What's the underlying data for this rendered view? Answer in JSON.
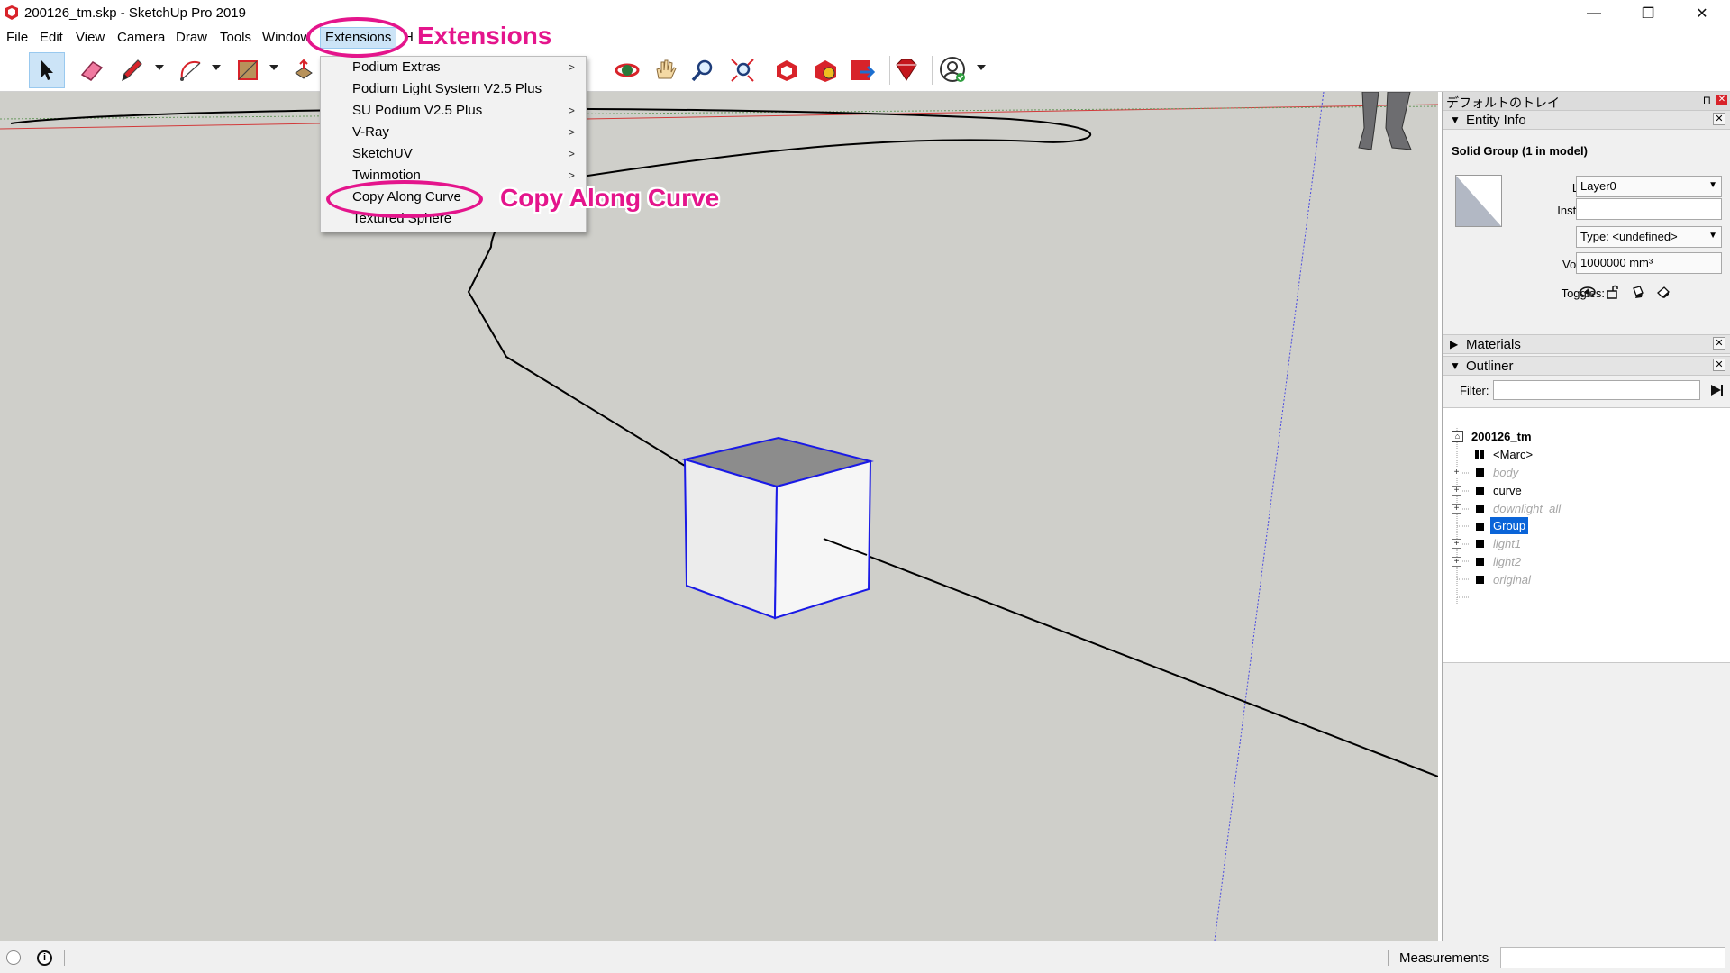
{
  "window": {
    "title": "200126_tm.skp - SketchUp Pro 2019",
    "minimize": "—",
    "maximize": "❐",
    "close": "✕"
  },
  "menubar": {
    "items": [
      "File",
      "Edit",
      "View",
      "Camera",
      "Draw",
      "Tools",
      "Window",
      "Extensions",
      "H"
    ]
  },
  "extensions_menu": {
    "items": [
      {
        "label": "Podium Extras",
        "submenu": true
      },
      {
        "label": "Podium Light System V2.5 Plus",
        "submenu": false
      },
      {
        "label": "SU Podium V2.5 Plus",
        "submenu": true
      },
      {
        "label": "V-Ray",
        "submenu": true
      },
      {
        "label": "SketchUV",
        "submenu": true
      },
      {
        "label": "Twinmotion",
        "submenu": true
      },
      {
        "label": "Copy Along Curve",
        "submenu": false
      },
      {
        "label": "Textured Sphere",
        "submenu": false
      }
    ],
    "submenu_glyph": ">"
  },
  "annotations": {
    "extensions": "Extensions",
    "copy_along_curve": "Copy Along Curve",
    "color": "#e4158c"
  },
  "toolbar": {
    "tools": [
      "select-tool",
      "eraser-tool",
      "pencil-tool",
      "arc-tool",
      "rectangle-tool",
      "push-pull-tool",
      "orbit-tool",
      "pan-tool",
      "zoom-tool",
      "zoom-extents-tool",
      "3d-warehouse",
      "extension-warehouse",
      "layout-send",
      "extension-manager",
      "account"
    ]
  },
  "tray": {
    "title": "デフォルトのトレイ",
    "entity_info": {
      "header": "Entity Info",
      "summary": "Solid Group (1 in model)",
      "layer_label": "Layer:",
      "layer_value": "Layer0",
      "instance_label": "Instance:",
      "instance_value": "",
      "type_label": "Type:",
      "type_value": "Type: <undefined>",
      "volume_label": "Volume:",
      "volume_value": "1000000 mm³",
      "toggles_label": "Toggles:"
    },
    "materials": {
      "header": "Materials"
    },
    "outliner": {
      "header": "Outliner",
      "filter_label": "Filter:",
      "filter_value": "",
      "model_name": "200126_tm",
      "rows": [
        {
          "name": "<Marc>",
          "expandable": false,
          "hidden": false,
          "selected": false,
          "component": true
        },
        {
          "name": "body",
          "expandable": true,
          "hidden": true,
          "selected": false,
          "component": false
        },
        {
          "name": "curve",
          "expandable": true,
          "hidden": false,
          "selected": false,
          "component": false
        },
        {
          "name": "downlight_all",
          "expandable": true,
          "hidden": true,
          "selected": false,
          "component": false
        },
        {
          "name": "Group",
          "expandable": false,
          "hidden": false,
          "selected": true,
          "component": false
        },
        {
          "name": "light1",
          "expandable": true,
          "hidden": true,
          "selected": false,
          "component": false
        },
        {
          "name": "light2",
          "expandable": true,
          "hidden": true,
          "selected": false,
          "component": false
        },
        {
          "name": "original",
          "expandable": false,
          "hidden": true,
          "selected": false,
          "component": false
        }
      ]
    }
  },
  "statusbar": {
    "measurements_label": "Measurements",
    "measurements_value": ""
  }
}
